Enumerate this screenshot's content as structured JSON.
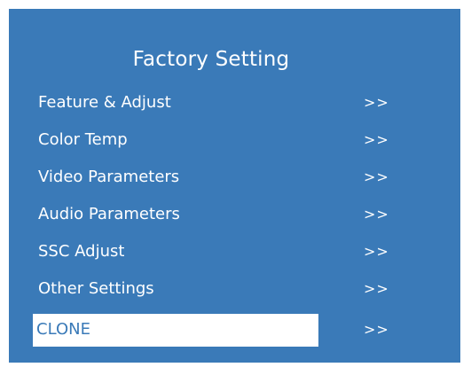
{
  "colors": {
    "panel_background": "#3a7ab8",
    "text": "#ffffff",
    "selected_background": "#ffffff",
    "selected_text": "#3a7ab8"
  },
  "menu": {
    "title": "Factory Setting",
    "selected_index": 6,
    "items": [
      {
        "label": "Feature & Adjust",
        "arrow": ">>"
      },
      {
        "label": "Color Temp",
        "arrow": ">>"
      },
      {
        "label": "Video Parameters",
        "arrow": ">>"
      },
      {
        "label": "Audio Parameters",
        "arrow": ">>"
      },
      {
        "label": "SSC Adjust",
        "arrow": ">>"
      },
      {
        "label": "Other Settings",
        "arrow": ">>"
      },
      {
        "label": "CLONE",
        "arrow": ">>"
      }
    ]
  }
}
